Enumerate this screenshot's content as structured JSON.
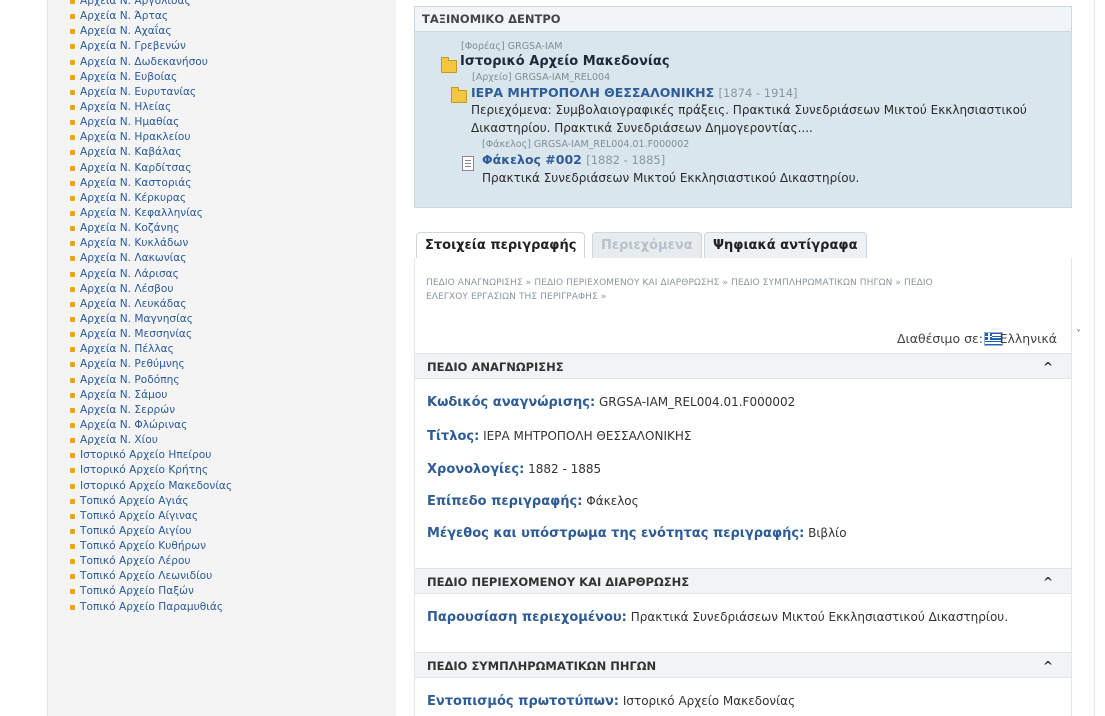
{
  "sidebar": {
    "items": [
      "Αρχεία Ν. Αργολίδας",
      "Αρχεία Ν. Άρτας",
      "Αρχεία Ν. Αχαΐας",
      "Αρχεία Ν. Γρεβενών",
      "Αρχεία Ν. Δωδεκανήσου",
      "Αρχεία Ν. Ευβοίας",
      "Αρχεία Ν. Ευρυτανίας",
      "Αρχεία Ν. Ηλείας",
      "Αρχεία Ν. Ημαθίας",
      "Αρχεία Ν. Ηρακλείου",
      "Αρχεία Ν. Καβάλας",
      "Αρχεία Ν. Καρδίτσας",
      "Αρχεία Ν. Καστοριάς",
      "Αρχεία Ν. Κέρκυρας",
      "Αρχεία Ν. Κεφαλληνίας",
      "Αρχεία Ν. Κοζάνης",
      "Αρχεία Ν. Κυκλάδων",
      "Αρχεία Ν. Λακωνίας",
      "Αρχεία Ν. Λάρισας",
      "Αρχεία Ν. Λέσβου",
      "Αρχεία Ν. Λευκάδας",
      "Αρχεία Ν. Μαγνησίας",
      "Αρχεία Ν. Μεσσηνίας",
      "Αρχεία Ν. Πέλλας",
      "Αρχεία Ν. Ρεθύμνης",
      "Αρχεία Ν. Ροδόπης",
      "Αρχεία Ν. Σάμου",
      "Αρχεία Ν. Σερρών",
      "Αρχεία Ν. Φλώρινας",
      "Αρχεία Ν. Χίου",
      "Ιστορικό Αρχείο Ηπείρου",
      "Ιστορικό Αρχείο Κρήτης",
      "Ιστορικό Αρχείο Μακεδονίας",
      "Τοπικό Αρχείο Αγιάς",
      "Τοπικό Αρχείο Αίγινας",
      "Τοπικό Αρχείο Αιγίου",
      "Τοπικό Αρχείο Κυθήρων",
      "Τοπικό Αρχείο Λέρου",
      "Τοπικό Αρχείο Λεωνιδίου",
      "Τοπικό Αρχείο Παξών",
      "Τοπικό Αρχείο Παραμυθιάς"
    ]
  },
  "tree": {
    "header": "ΤΑΞΙΝΟΜΙΚΟ ΔΕΝΤΡΟ",
    "holder_meta": "[Φορέας] GRGSA-IAM",
    "holder_title": "Ιστορικό Αρχείο Μακεδονίας",
    "fonds_meta": "[Αρχείο] GRGSA-IAM_REL004",
    "fonds_title": "ΙΕΡΑ ΜΗΤΡΟΠΟΛΗ ΘΕΣΣΑΛΟΝΙΚΗΣ",
    "fonds_dates": "[1874 - 1914]",
    "fonds_desc_1": "Περιεχόμενα: Συμβολαιογραφικές πράξεις. Πρακτικά Συνεδριάσεων Μικτού Εκκλησιαστικού",
    "fonds_desc_2": "Δικαστηρίου. Πρακτικά Συνεδριάσεων Δημογεροντίας....",
    "file_meta": "[Φάκελος] GRGSA-IAM_REL004.01.F000002",
    "file_title": "Φάκελος #002",
    "file_dates": "[1882 - 1885]",
    "file_desc": "Πρακτικά Συνεδριάσεων Μικτού Εκκλησιαστικού Δικαστηρίου."
  },
  "tabs": {
    "description": "Στοιχεία περιγραφής",
    "contents": "Περιεχόμενα",
    "digital": "Ψηφιακά αντίγραφα"
  },
  "breadcrumbs": {
    "line1": "ΠΕΔΙΟ ΑΝΑΓΝΩΡΙΣΗΣ »  ΠΕΔΙΟ ΠΕΡΙΕΧΟΜΕΝΟΥ ΚΑΙ ΔΙΑΡΘΡΩΣΗΣ »  ΠΕΔΙΟ ΣΥΜΠΛΗΡΩΜΑΤΙΚΩΝ ΠΗΓΩΝ »  ΠΕΔΙΟ",
    "line2": "ΕΛΕΓΧΟΥ ΕΡΓΑΣΙΩΝ ΤΗΣ ΠΕΡΙΓΡΑΦΗΣ »"
  },
  "availability": {
    "label": "Διαθέσιμο σε:",
    "language": "Ελληνικά",
    "caret": "˅"
  },
  "sections": {
    "identity": {
      "title": "ΠΕΔΙΟ ΑΝΑΓΝΩΡΙΣΗΣ",
      "chevron": "^",
      "ref_key": "Κωδικός αναγνώρισης:",
      "ref_val": "GRGSA-IAM_REL004.01.F000002",
      "title_key": "Τίτλος:",
      "title_val": "ΙΕΡΑ ΜΗΤΡΟΠΟΛΗ ΘΕΣΣΑΛΟΝΙΚΗΣ",
      "dates_key": "Χρονολογίες:",
      "dates_val": "1882 - 1885",
      "level_key": "Επίπεδο περιγραφής:",
      "level_val": "Φάκελος",
      "extent_key": "Μέγεθος και υπόστρωμα της ενότητας περιγραφής:",
      "extent_val": "Βιβλίο"
    },
    "content": {
      "title": "ΠΕΔΙΟ ΠΕΡΙΕΧΟΜΕΝΟΥ ΚΑΙ ΔΙΑΡΘΡΩΣΗΣ",
      "chevron": "^",
      "scope_key": "Παρουσίαση περιεχομένου:",
      "scope_val": "Πρακτικά Συνεδριάσεων Μικτού Εκκλησιαστικού Δικαστηρίου."
    },
    "allied": {
      "title": "ΠΕΔΙΟ ΣΥΜΠΛΗΡΩΜΑΤΙΚΩΝ ΠΗΓΩΝ",
      "chevron": "^",
      "orig_key": "Εντοπισμός πρωτοτύπων:",
      "orig_val": "Ιστορικό Αρχείο Μακεδονίας"
    }
  }
}
